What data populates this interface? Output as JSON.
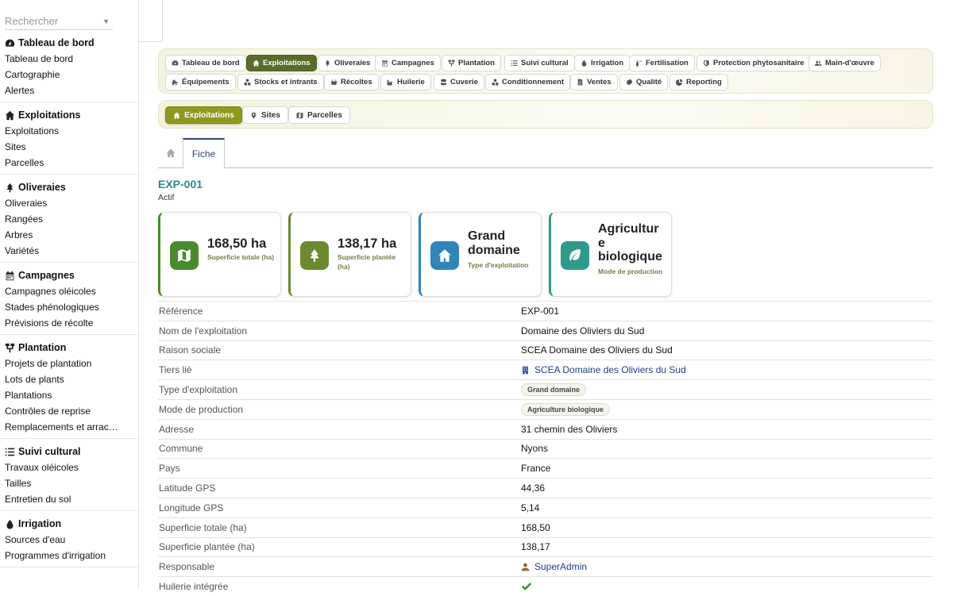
{
  "search": {
    "placeholder": "Rechercher"
  },
  "sidebar": {
    "sections": [
      {
        "title": "Tableau de bord",
        "icon": "dashboard-icon",
        "items": [
          "Tableau de bord",
          "Cartographie",
          "Alertes"
        ]
      },
      {
        "title": "Exploitations",
        "icon": "home-icon",
        "items": [
          "Exploitations",
          "Sites",
          "Parcelles"
        ]
      },
      {
        "title": "Oliveraies",
        "icon": "tree-icon",
        "items": [
          "Oliveraies",
          "Rangées",
          "Arbres",
          "Variétés"
        ]
      },
      {
        "title": "Campagnes",
        "icon": "calendar-icon",
        "items": [
          "Campagnes oléicoles",
          "Stades phénologiques",
          "Prévisions de récolte"
        ]
      },
      {
        "title": "Plantation",
        "icon": "sitemap-icon",
        "items": [
          "Projets de plantation",
          "Lots de plants",
          "Plantations",
          "Contrôles de reprise",
          "Remplacements et arrac…"
        ]
      },
      {
        "title": "Suivi cultural",
        "icon": "list-icon",
        "items": [
          "Travaux oléicoles",
          "Tailles",
          "Entretien du sol"
        ]
      },
      {
        "title": "Irrigation",
        "icon": "droplet-icon",
        "items": [
          "Sources d'eau",
          "Programmes d'irrigation"
        ]
      }
    ]
  },
  "modules": [
    {
      "label": "Tableau de bord",
      "icon": "dashboard-icon",
      "active": false
    },
    {
      "label": "Exploitations",
      "icon": "home-icon",
      "active": true
    },
    {
      "label": "Oliveraies",
      "icon": "tree-icon",
      "active": false
    },
    {
      "label": "Campagnes",
      "icon": "calendar-icon",
      "active": false
    },
    {
      "label": "Plantation",
      "icon": "sitemap-icon",
      "active": false
    },
    {
      "label": "Suivi cultural",
      "icon": "list-icon",
      "active": false
    },
    {
      "label": "Irrigation",
      "icon": "droplet-icon",
      "active": false
    },
    {
      "label": "Fertilisation",
      "icon": "spray-icon",
      "active": false
    },
    {
      "label": "Protection phytosanitaire",
      "icon": "shield-icon",
      "active": false
    },
    {
      "label": "Main-d'œuvre",
      "icon": "users-icon",
      "active": false
    },
    {
      "label": "Équipements",
      "icon": "tractor-icon",
      "active": false
    },
    {
      "label": "Stocks et intrants",
      "icon": "boxes-icon",
      "active": false
    },
    {
      "label": "Récoltes",
      "icon": "basket-icon",
      "active": false
    },
    {
      "label": "Huilerie",
      "icon": "industry-icon",
      "active": false
    },
    {
      "label": "Cuverie",
      "icon": "database-icon",
      "active": false
    },
    {
      "label": "Conditionnement",
      "icon": "boxes-icon",
      "active": false
    },
    {
      "label": "Ventes",
      "icon": "invoice-icon",
      "active": false
    },
    {
      "label": "Qualité",
      "icon": "certificate-icon",
      "active": false
    },
    {
      "label": "Reporting",
      "icon": "chart-pie-icon",
      "active": false
    }
  ],
  "submodules": [
    {
      "label": "Exploitations",
      "icon": "home-icon",
      "active": true
    },
    {
      "label": "Sites",
      "icon": "map-pin-icon",
      "active": false
    },
    {
      "label": "Parcelles",
      "icon": "map-icon",
      "active": false
    }
  ],
  "tabs": {
    "fiche": "Fiche"
  },
  "record": {
    "code": "EXP-001",
    "status": "Actif"
  },
  "cards": [
    {
      "value": "168,50 ha",
      "label": "Superficie totale (ha)",
      "icon": "map-icon",
      "color": "#4a8a2e"
    },
    {
      "value": "138,17 ha",
      "label": "Superficie plantée (ha)",
      "icon": "tree-icon",
      "color": "#6b8a2e"
    },
    {
      "value": "Grand domaine",
      "label": "Type d'exploitation",
      "icon": "home-icon",
      "color": "#2e86b8"
    },
    {
      "value": "Agricultur e biologique",
      "label": "Mode de production",
      "icon": "leaf-icon",
      "color": "#2e9a8a"
    }
  ],
  "details": [
    {
      "key": "Référence",
      "value": "EXP-001",
      "kind": "text"
    },
    {
      "key": "Nom de l'exploitation",
      "value": "Domaine des Oliviers du Sud",
      "kind": "text"
    },
    {
      "key": "Raison sociale",
      "value": "SCEA Domaine des Oliviers du Sud",
      "kind": "text"
    },
    {
      "key": "Tiers lié",
      "value": "SCEA Domaine des Oliviers du Sud",
      "kind": "link",
      "icon": "building-icon"
    },
    {
      "key": "Type d'exploitation",
      "value": "Grand domaine",
      "kind": "badge"
    },
    {
      "key": "Mode de production",
      "value": "Agriculture biologique",
      "kind": "badge"
    },
    {
      "key": "Adresse",
      "value": "31 chemin des Oliviers",
      "kind": "text"
    },
    {
      "key": "Commune",
      "value": "Nyons",
      "kind": "text"
    },
    {
      "key": "Pays",
      "value": "France",
      "kind": "text"
    },
    {
      "key": "Latitude GPS",
      "value": "44,36",
      "kind": "text"
    },
    {
      "key": "Longitude GPS",
      "value": "5,14",
      "kind": "text"
    },
    {
      "key": "Superficie totale (ha)",
      "value": "168,50",
      "kind": "text"
    },
    {
      "key": "Superficie plantée (ha)",
      "value": "138,17",
      "kind": "text"
    },
    {
      "key": "Responsable",
      "value": "SuperAdmin",
      "kind": "link",
      "icon": "user-icon"
    },
    {
      "key": "Huilerie intégrée",
      "value": "",
      "kind": "check",
      "icon": "check-icon"
    }
  ]
}
